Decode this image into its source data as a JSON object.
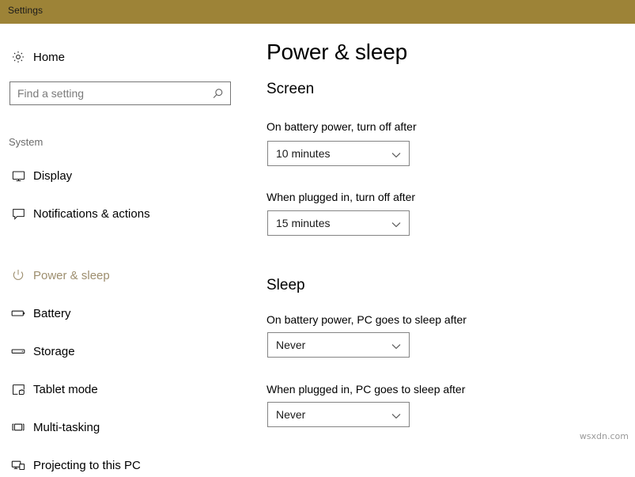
{
  "window": {
    "title": "Settings",
    "titlebar_color": "#9d8337"
  },
  "sidebar": {
    "home": {
      "label": "Home",
      "icon": "gear-icon"
    },
    "search": {
      "placeholder": "Find a setting",
      "value": "",
      "icon": "search-icon"
    },
    "group_title": "System",
    "accent_color": "#9d8e6e",
    "items": [
      {
        "label": "Display",
        "icon": "monitor-icon",
        "active": false
      },
      {
        "label": "Notifications & actions",
        "icon": "speech-bubble-icon",
        "active": false
      },
      {
        "label": "Power & sleep",
        "icon": "power-icon",
        "active": true
      },
      {
        "label": "Battery",
        "icon": "battery-icon",
        "active": false
      },
      {
        "label": "Storage",
        "icon": "storage-icon",
        "active": false
      },
      {
        "label": "Tablet mode",
        "icon": "tablet-hand-icon",
        "active": false
      },
      {
        "label": "Multi-tasking",
        "icon": "multitask-icon",
        "active": false
      },
      {
        "label": "Projecting to this PC",
        "icon": "projecting-icon",
        "active": false
      }
    ]
  },
  "main": {
    "page_title": "Power & sleep",
    "sections": [
      {
        "heading": "Screen",
        "fields": [
          {
            "label": "On battery power, turn off after",
            "value": "10 minutes"
          },
          {
            "label": "When plugged in, turn off after",
            "value": "15 minutes"
          }
        ]
      },
      {
        "heading": "Sleep",
        "fields": [
          {
            "label": "On battery power, PC goes to sleep after",
            "value": "Never"
          },
          {
            "label": "When plugged in, PC goes to sleep after",
            "value": "Never"
          }
        ]
      }
    ]
  },
  "watermark": "wsxdn.com"
}
